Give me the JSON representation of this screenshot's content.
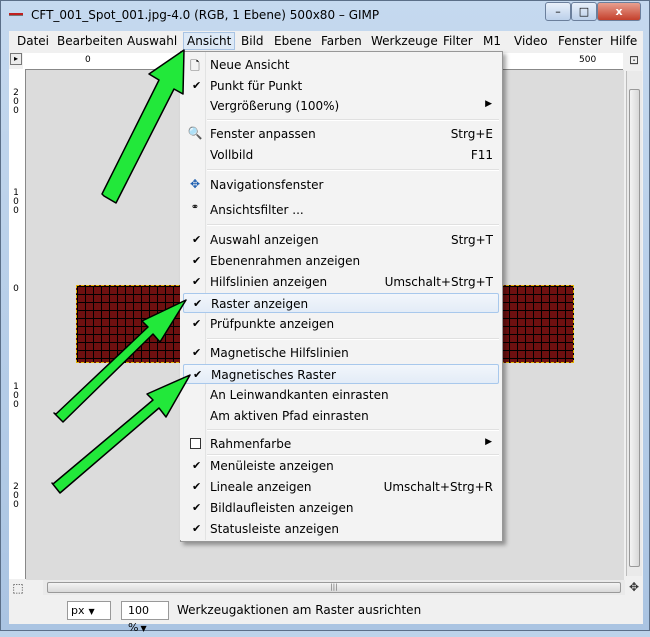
{
  "window": {
    "title": "CFT_001_Spot_001.jpg-4.0 (RGB, 1 Ebene) 500x80 – GIMP",
    "controls": {
      "minimize": "–",
      "maximize": "□",
      "close": "x"
    }
  },
  "menubar": [
    "Datei",
    "Bearbeiten",
    "Auswahl",
    "Ansicht",
    "Bild",
    "Ebene",
    "Farben",
    "Werkzeuge",
    "Filter",
    "M1",
    "Video",
    "Fenster",
    "Hilfe"
  ],
  "rulers": {
    "h_labels": [
      "0",
      "500"
    ],
    "v_labels": [
      "2\n0\n0",
      "1\n0\n0",
      "0",
      "1\n0\n0",
      "2\n0\n0"
    ]
  },
  "dropdown": {
    "items": [
      {
        "label": "Neue Ansicht",
        "icon": "new-view-icon"
      },
      {
        "label": "Punkt für Punkt",
        "check": true
      },
      {
        "label": "Vergrößerung (100%)",
        "submenu": true
      },
      {
        "label": "Fenster anpassen",
        "shortcut": "Strg+E",
        "icon": "zoom-icon"
      },
      {
        "label": "Vollbild",
        "shortcut": "F11"
      },
      {
        "label": "Navigationsfenster",
        "icon": "navigation-icon"
      },
      {
        "label": "Ansichtsfilter ...",
        "icon": "glasses-icon"
      },
      {
        "label": "Auswahl anzeigen",
        "shortcut": "Strg+T",
        "check": true
      },
      {
        "label": "Ebenenrahmen anzeigen",
        "check": true
      },
      {
        "label": "Hilfslinien anzeigen",
        "shortcut": "Umschalt+Strg+T",
        "check": true
      },
      {
        "label": "Raster anzeigen",
        "check": true
      },
      {
        "label": "Prüfpunkte anzeigen",
        "check": true
      },
      {
        "label": "Magnetische Hilfslinien",
        "check": true
      },
      {
        "label": "Magnetisches Raster",
        "check": true
      },
      {
        "label": "An Leinwandkanten einrasten"
      },
      {
        "label": "Am aktiven Pfad einrasten"
      },
      {
        "label": "Rahmenfarbe",
        "submenu": true,
        "checkbox_empty": true
      },
      {
        "label": "Menüleiste anzeigen",
        "check": true
      },
      {
        "label": "Lineale anzeigen",
        "shortcut": "Umschalt+Strg+R",
        "check": true
      },
      {
        "label": "Bildlaufleisten anzeigen",
        "check": true
      },
      {
        "label": "Statusleiste anzeigen",
        "check": true
      }
    ]
  },
  "statusbar": {
    "unit": "px",
    "zoom": "100 %",
    "message": "Werkzeugaktionen am Raster ausrichten"
  },
  "colors": {
    "arrow_fill": "#22e83a",
    "image_fill": "#6e1010",
    "highlight_border": "#a8c8ec"
  }
}
